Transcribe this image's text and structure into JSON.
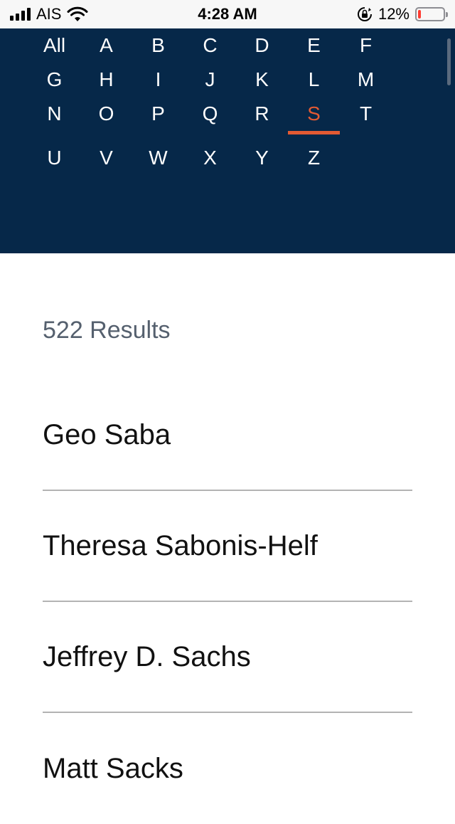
{
  "status_bar": {
    "carrier": "AIS",
    "time": "4:28 AM",
    "battery_percent": "12%",
    "battery_level": 0.12,
    "icons": [
      "signal-icon",
      "wifi-icon",
      "orientation-lock-icon",
      "battery-icon"
    ]
  },
  "alphabet": {
    "letters": [
      "All",
      "A",
      "B",
      "C",
      "D",
      "E",
      "F",
      "G",
      "H",
      "I",
      "J",
      "K",
      "L",
      "M",
      "N",
      "O",
      "P",
      "Q",
      "R",
      "S",
      "T",
      "U",
      "V",
      "W",
      "X",
      "Y",
      "Z"
    ],
    "selected": "S",
    "colors": {
      "background": "#062849",
      "letter": "#ffffff",
      "active": "#e35a33"
    }
  },
  "results": {
    "count_label": "522 Results",
    "items": [
      "Geo Saba",
      "Theresa Sabonis-Helf",
      "Jeffrey D. Sachs",
      "Matt Sacks"
    ]
  }
}
